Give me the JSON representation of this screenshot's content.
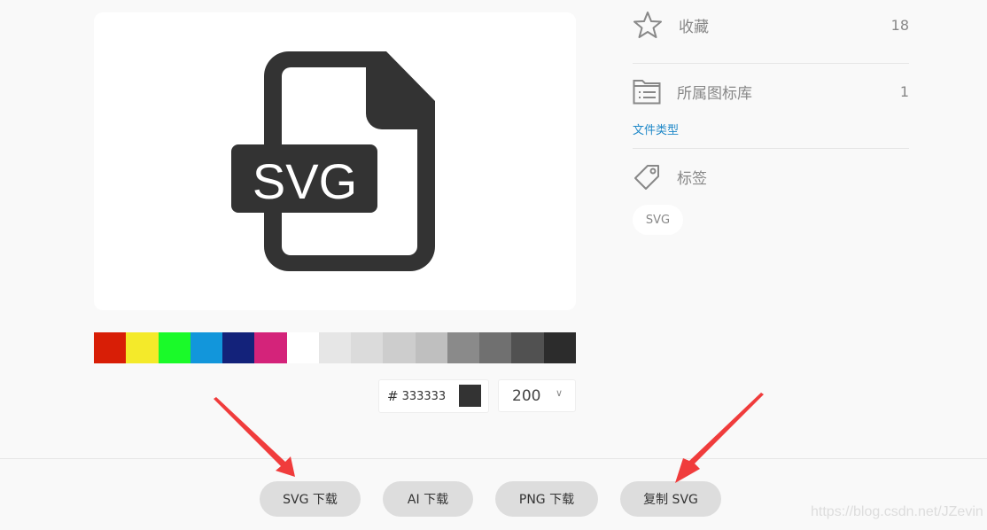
{
  "preview": {
    "icon_label": "SVG",
    "icon_color": "#333333"
  },
  "palette": [
    "#d81e06",
    "#f4ea2a",
    "#1afa29",
    "#1296db",
    "#13227a",
    "#d4237a",
    "#ffffff",
    "#e6e6e6",
    "#dbdbdb",
    "#cdcdcd",
    "#bfbfbf",
    "#8a8a8a",
    "#707070",
    "#515151",
    "#2c2c2c"
  ],
  "color_input": {
    "hash": "#",
    "value": "333333"
  },
  "size_select": {
    "value": "200"
  },
  "meta": {
    "favorites": {
      "label": "收藏",
      "count": "18"
    },
    "library": {
      "label": "所属图标库",
      "count": "1",
      "link": "文件类型"
    },
    "tags": {
      "label": "标签",
      "items": [
        "SVG"
      ]
    }
  },
  "buttons": {
    "svg_download": "SVG 下载",
    "ai_download": "AI 下载",
    "png_download": "PNG 下载",
    "copy_svg": "复制 SVG"
  },
  "watermark": "https://blog.csdn.net/JZevin",
  "annotation_color": "#f03c3c"
}
